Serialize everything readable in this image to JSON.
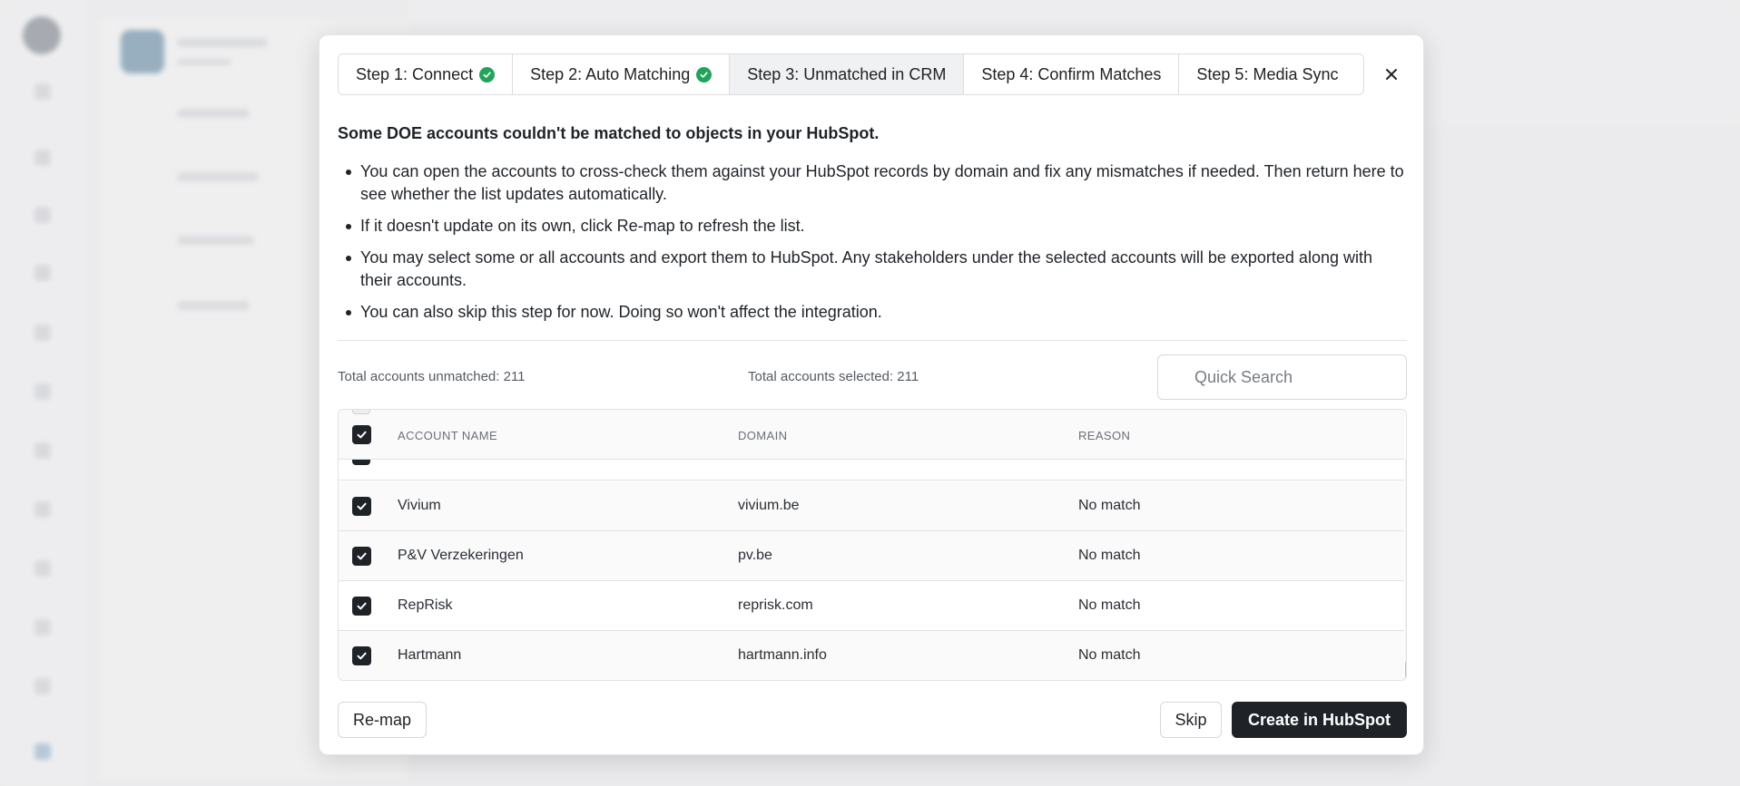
{
  "stepper": {
    "steps": [
      {
        "label": "Step 1: Connect",
        "completed": true
      },
      {
        "label": "Step 2: Auto Matching",
        "completed": true
      },
      {
        "label": "Step 3: Unmatched in CRM",
        "completed": false,
        "active": true
      },
      {
        "label": "Step 4: Confirm Matches",
        "completed": false
      },
      {
        "label": "Step 5: Media Sync",
        "completed": false
      }
    ],
    "close_icon": "close-icon"
  },
  "intro": "Some DOE accounts couldn't be matched to objects in your HubSpot.",
  "bullets": [
    "You can open the accounts to cross-check them against your HubSpot records by domain and fix any mismatches if needed. Then return here to see whether the list updates automatically.",
    "If it doesn't update on its own, click Re-map to refresh the list.",
    "You may select some or all accounts and export them to HubSpot. Any stakeholders under the selected accounts will be exported along with their accounts.",
    "You can also skip this step for now. Doing so won't affect the integration."
  ],
  "stats": {
    "unmatched": "Total accounts unmatched: 211",
    "selected": "Total accounts selected: 211"
  },
  "search": {
    "placeholder": "Quick Search",
    "value": ""
  },
  "table": {
    "headers": [
      "ACCOUNT NAME",
      "DOMAIN",
      "REASON"
    ],
    "header_checkbox_checked": true,
    "rows": [
      {
        "name": "Vivium",
        "domain": "vivium.be",
        "reason": "No match",
        "checked": true
      },
      {
        "name": "P&V Verzekeringen",
        "domain": "pv.be",
        "reason": "No match",
        "checked": true
      },
      {
        "name": "RepRisk",
        "domain": "reprisk.com",
        "reason": "No match",
        "checked": true
      },
      {
        "name": "Hartmann",
        "domain": "hartmann.info",
        "reason": "No match",
        "checked": true
      }
    ]
  },
  "footer": {
    "remap_label": "Re-map",
    "skip_label": "Skip",
    "create_label": "Create in HubSpot"
  },
  "colors": {
    "success": "#22a35a",
    "primary": "#1f2328",
    "active_step_bg": "#f0f1f3"
  }
}
